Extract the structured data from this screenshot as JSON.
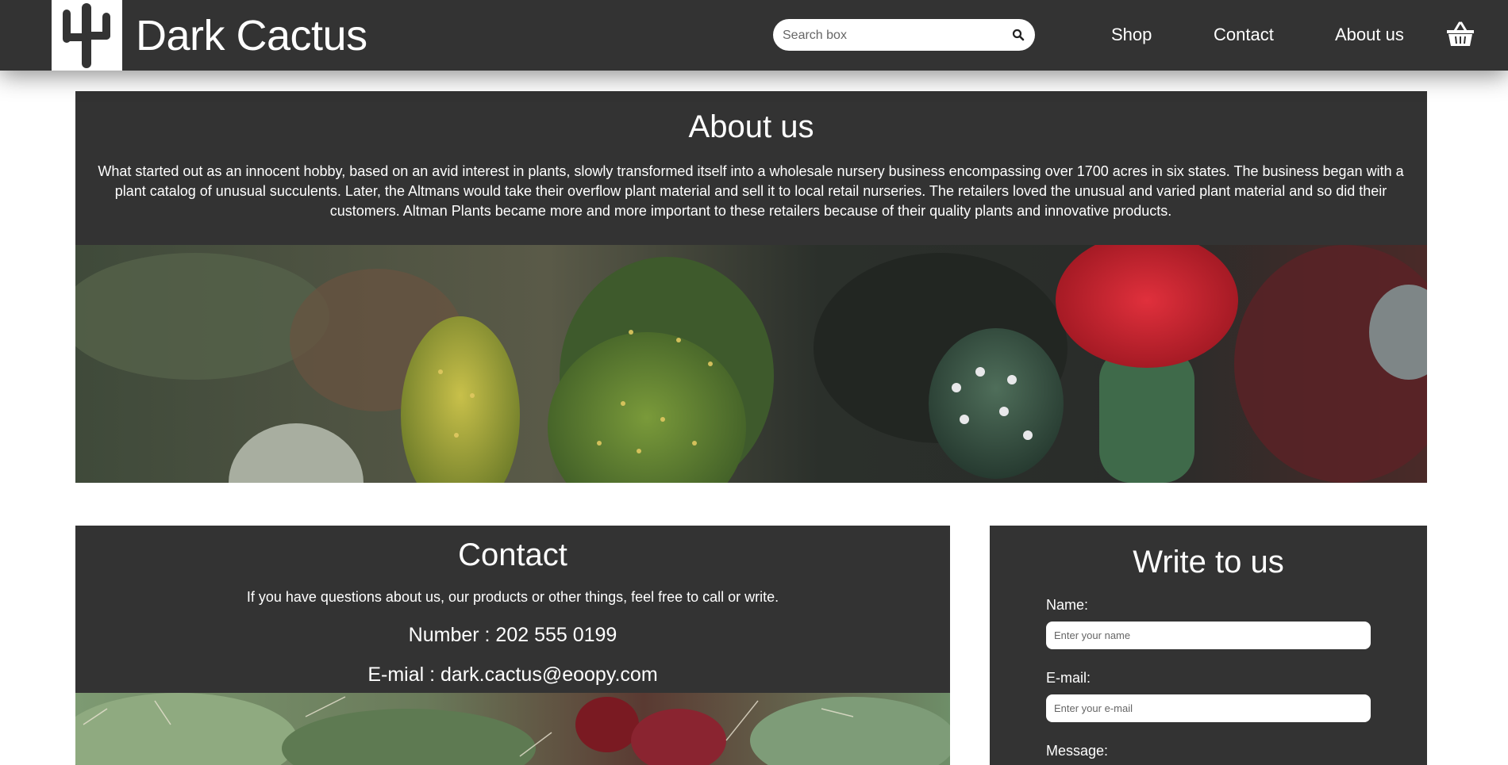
{
  "brand": {
    "name": "Dark Cactus",
    "logo_icon": "cactus-icon"
  },
  "header": {
    "search": {
      "placeholder": "Search box",
      "value": "",
      "icon": "search-icon"
    },
    "nav": [
      "Shop",
      "Contact",
      "About us"
    ],
    "cart_icon": "basket-icon"
  },
  "about": {
    "title": "About us",
    "text": "What started out as an innocent hobby, based on an avid interest in plants, slowly transformed itself into a wholesale nursery business encompassing over 1700 acres in six states. The business began with a plant catalog of unusual succulents. Later, the Altmans would take their overflow plant material and sell it to local retail nurseries. The retailers loved the unusual and varied plant material and so did their customers. Altman Plants became more and more important to these retailers because of their quality plants and innovative products."
  },
  "contact": {
    "title": "Contact",
    "intro": "If you have questions about us, our products or other things, feel free to call or write.",
    "number": "Number : 202 555 0199",
    "email": "E-mial : dark.cactus@eoopy.com"
  },
  "write": {
    "title": "Write to us",
    "name_label": "Name:",
    "name_placeholder": "Enter your name",
    "email_label": "E-mail:",
    "email_placeholder": "Enter your e-mail",
    "message_label": "Message:"
  },
  "colors": {
    "panel": "#333333",
    "text": "#ffffff",
    "page": "#ffffff"
  }
}
